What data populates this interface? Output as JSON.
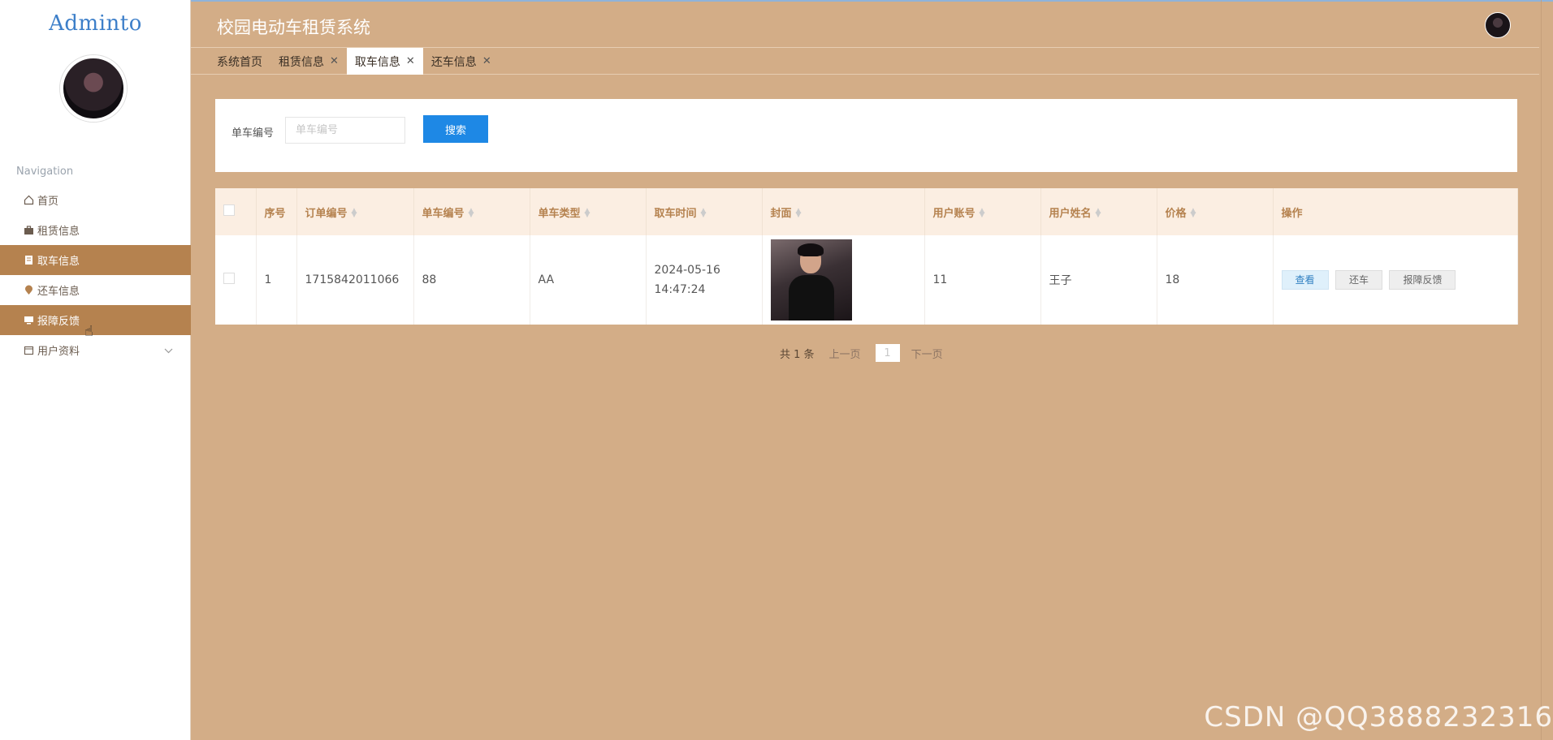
{
  "sidebar": {
    "logo": "Adminto",
    "nav_title": "Navigation",
    "items": [
      {
        "label": "首页"
      },
      {
        "label": "租赁信息"
      },
      {
        "label": "取车信息"
      },
      {
        "label": "还车信息"
      },
      {
        "label": "报障反馈"
      },
      {
        "label": "用户资料"
      }
    ]
  },
  "header": {
    "title": "校园电动车租赁系统"
  },
  "tabs": [
    {
      "label": "系统首页",
      "closable": false
    },
    {
      "label": "租赁信息",
      "closable": true
    },
    {
      "label": "取车信息",
      "closable": true,
      "active": true
    },
    {
      "label": "还车信息",
      "closable": true
    }
  ],
  "search": {
    "label": "单车编号",
    "placeholder": "单车编号",
    "button": "搜索"
  },
  "table": {
    "columns": [
      "序号",
      "订单编号",
      "单车编号",
      "单车类型",
      "取车时间",
      "封面",
      "用户账号",
      "用户姓名",
      "价格",
      "操作"
    ],
    "rows": [
      {
        "index": "1",
        "order_no": "1715842011066",
        "bike_no": "88",
        "bike_type": "AA",
        "pickup_time": "2024-05-16 14:47:24",
        "account": "11",
        "name": "王子",
        "price": "18"
      }
    ],
    "actions": [
      "查看",
      "还车",
      "报障反馈"
    ]
  },
  "pagination": {
    "total": "共 1 条",
    "prev": "上一页",
    "page": "1",
    "next": "下一页"
  },
  "watermark": "CSDN @QQ3888232316",
  "colors": {
    "background": "#d3ad87",
    "sidebar_active": "#b5824f",
    "header_th": "#b5824f",
    "search_button": "#1e88e5"
  }
}
